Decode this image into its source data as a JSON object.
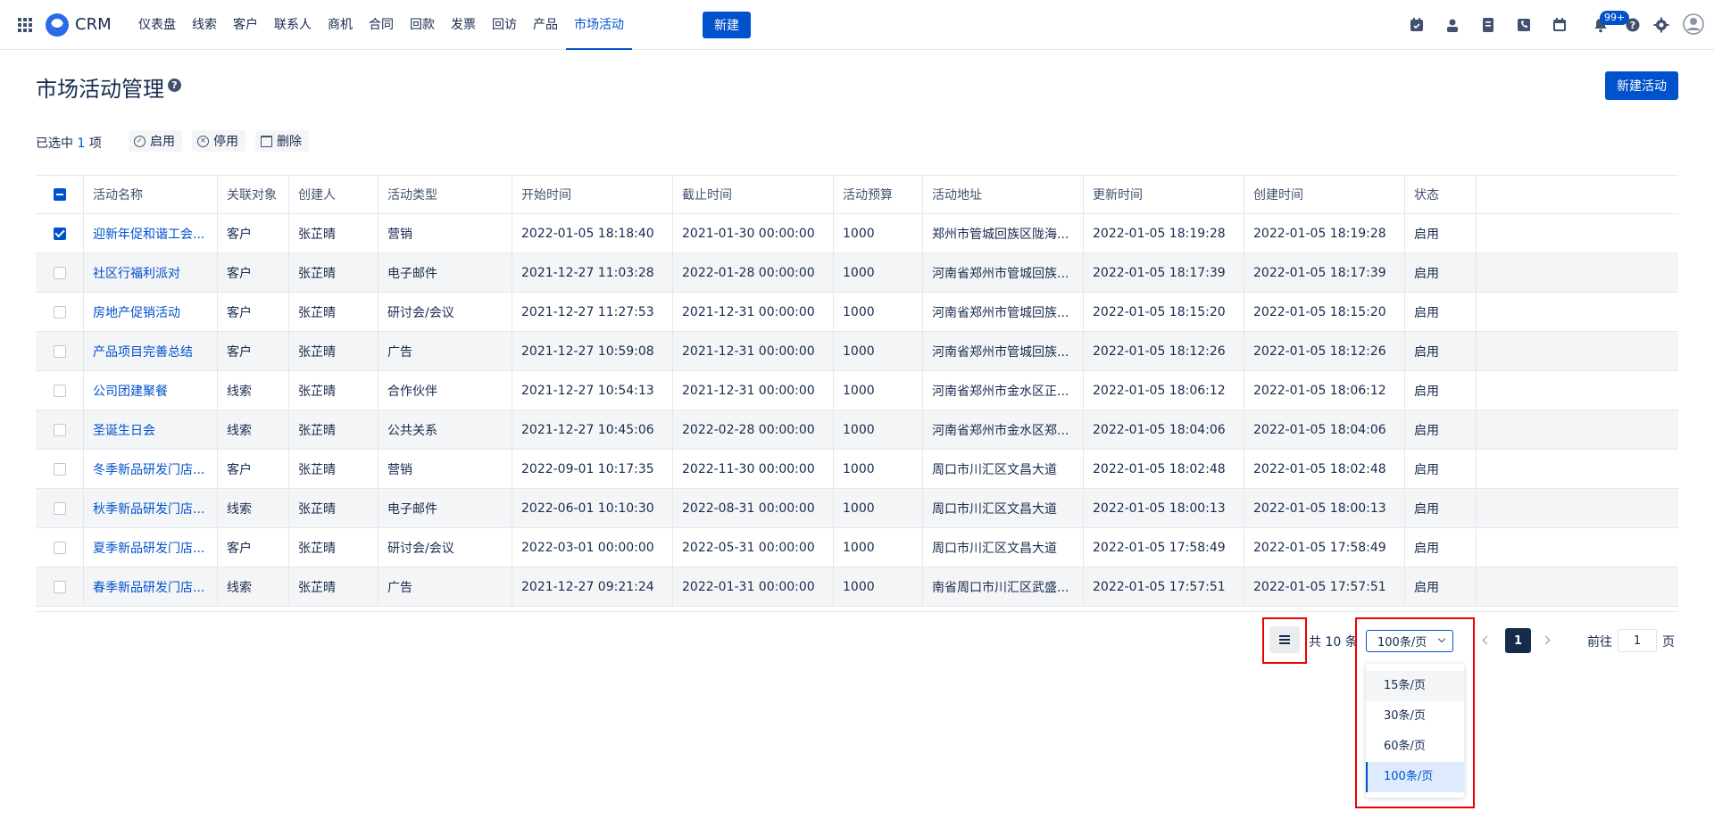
{
  "topbar": {
    "brand": "CRM",
    "nav": [
      "仪表盘",
      "线索",
      "客户",
      "联系人",
      "商机",
      "合同",
      "回款",
      "发票",
      "回访",
      "产品",
      "市场活动"
    ],
    "active_nav": "市场活动",
    "new_label": "新建",
    "notification_count": "99+"
  },
  "page": {
    "title": "市场活动管理",
    "create_label": "新建活动"
  },
  "selection": {
    "prefix": "已选中",
    "count": "1",
    "suffix": "项",
    "enable_label": "启用",
    "disable_label": "停用",
    "delete_label": "删除"
  },
  "table": {
    "columns": [
      "活动名称",
      "关联对象",
      "创建人",
      "活动类型",
      "开始时间",
      "截止时间",
      "活动预算",
      "活动地址",
      "更新时间",
      "创建时间",
      "状态"
    ],
    "rows": [
      {
        "checked": true,
        "name": "迎新年促和谐工会...",
        "relation": "客户",
        "creator": "张芷晴",
        "type": "营销",
        "start": "2022-01-05 18:18:40",
        "end": "2021-01-30 00:00:00",
        "budget": "1000",
        "address": "郑州市管城回族区陇海...",
        "updated": "2022-01-05 18:19:28",
        "created": "2022-01-05 18:19:28",
        "status": "启用"
      },
      {
        "checked": false,
        "name": "社区行福利派对",
        "relation": "客户",
        "creator": "张芷晴",
        "type": "电子邮件",
        "start": "2021-12-27 11:03:28",
        "end": "2022-01-28 00:00:00",
        "budget": "1000",
        "address": "河南省郑州市管城回族...",
        "updated": "2022-01-05 18:17:39",
        "created": "2022-01-05 18:17:39",
        "status": "启用"
      },
      {
        "checked": false,
        "name": "房地产促销活动",
        "relation": "客户",
        "creator": "张芷晴",
        "type": "研讨会/会议",
        "start": "2021-12-27 11:27:53",
        "end": "2021-12-31 00:00:00",
        "budget": "1000",
        "address": "河南省郑州市管城回族...",
        "updated": "2022-01-05 18:15:20",
        "created": "2022-01-05 18:15:20",
        "status": "启用"
      },
      {
        "checked": false,
        "name": "产品项目完善总结",
        "relation": "客户",
        "creator": "张芷晴",
        "type": "广告",
        "start": "2021-12-27 10:59:08",
        "end": "2021-12-31 00:00:00",
        "budget": "1000",
        "address": "河南省郑州市管城回族...",
        "updated": "2022-01-05 18:12:26",
        "created": "2022-01-05 18:12:26",
        "status": "启用"
      },
      {
        "checked": false,
        "name": "公司团建聚餐",
        "relation": "线索",
        "creator": "张芷晴",
        "type": "合作伙伴",
        "start": "2021-12-27 10:54:13",
        "end": "2021-12-31 00:00:00",
        "budget": "1000",
        "address": "河南省郑州市金水区正...",
        "updated": "2022-01-05 18:06:12",
        "created": "2022-01-05 18:06:12",
        "status": "启用"
      },
      {
        "checked": false,
        "name": "圣诞生日会",
        "relation": "线索",
        "creator": "张芷晴",
        "type": "公共关系",
        "start": "2021-12-27 10:45:06",
        "end": "2022-02-28 00:00:00",
        "budget": "1000",
        "address": "河南省郑州市金水区郑...",
        "updated": "2022-01-05 18:04:06",
        "created": "2022-01-05 18:04:06",
        "status": "启用"
      },
      {
        "checked": false,
        "name": "冬季新品研发门店...",
        "relation": "客户",
        "creator": "张芷晴",
        "type": "营销",
        "start": "2022-09-01 10:17:35",
        "end": "2022-11-30 00:00:00",
        "budget": "1000",
        "address": "周口市川汇区文昌大道",
        "updated": "2022-01-05 18:02:48",
        "created": "2022-01-05 18:02:48",
        "status": "启用"
      },
      {
        "checked": false,
        "name": "秋季新品研发门店...",
        "relation": "线索",
        "creator": "张芷晴",
        "type": "电子邮件",
        "start": "2022-06-01 10:10:30",
        "end": "2022-08-31 00:00:00",
        "budget": "1000",
        "address": "周口市川汇区文昌大道",
        "updated": "2022-01-05 18:00:13",
        "created": "2022-01-05 18:00:13",
        "status": "启用"
      },
      {
        "checked": false,
        "name": "夏季新品研发门店...",
        "relation": "客户",
        "creator": "张芷晴",
        "type": "研讨会/会议",
        "start": "2022-03-01 00:00:00",
        "end": "2022-05-31 00:00:00",
        "budget": "1000",
        "address": "周口市川汇区文昌大道",
        "updated": "2022-01-05 17:58:49",
        "created": "2022-01-05 17:58:49",
        "status": "启用"
      },
      {
        "checked": false,
        "name": "春季新品研发门店...",
        "relation": "线索",
        "creator": "张芷晴",
        "type": "广告",
        "start": "2021-12-27 09:21:24",
        "end": "2022-01-31 00:00:00",
        "budget": "1000",
        "address": "南省周口市川汇区武盛...",
        "updated": "2022-01-05 17:57:51",
        "created": "2022-01-05 17:57:51",
        "status": "启用"
      }
    ]
  },
  "pagination": {
    "total": "共 10 条",
    "page_size": "100条/页",
    "page_size_options": [
      "15条/页",
      "30条/页",
      "60条/页",
      "100条/页"
    ],
    "current_page": "1",
    "goto_label": "前往",
    "goto_value": "1",
    "goto_suffix": "页"
  },
  "colors": {
    "accent": "#0052cc",
    "highlight_box": "#ee0000"
  }
}
